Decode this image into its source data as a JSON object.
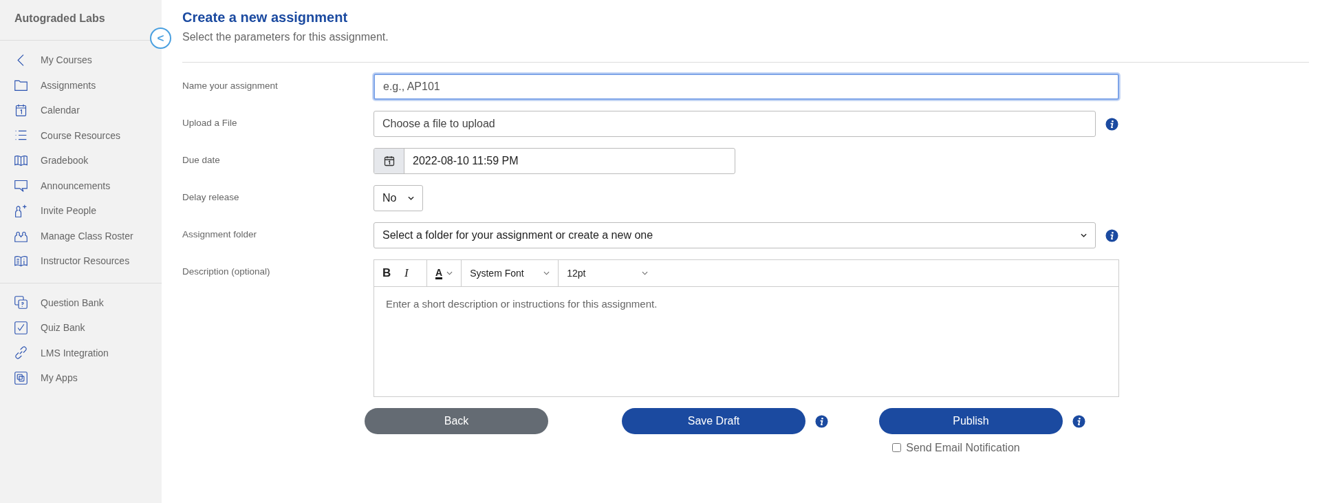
{
  "sidebar": {
    "title": "Autograded Labs",
    "collapse_label": "<",
    "groups": [
      {
        "items": [
          {
            "label": "My Courses",
            "kind": "chevron"
          },
          {
            "label": "Assignments",
            "kind": "folder"
          },
          {
            "label": "Calendar",
            "kind": "calendar"
          },
          {
            "label": "Course Resources",
            "kind": "list"
          },
          {
            "label": "Gradebook",
            "kind": "book"
          },
          {
            "label": "Announcements",
            "kind": "chat"
          },
          {
            "label": "Invite People",
            "kind": "person-plus"
          },
          {
            "label": "Manage Class Roster",
            "kind": "people"
          },
          {
            "label": "Instructor Resources",
            "kind": "book-info"
          }
        ]
      },
      {
        "items": [
          {
            "label": "Question Bank",
            "kind": "question"
          },
          {
            "label": "Quiz Bank",
            "kind": "check"
          },
          {
            "label": "LMS Integration",
            "kind": "link"
          },
          {
            "label": "My Apps",
            "kind": "apps"
          }
        ]
      }
    ]
  },
  "header": {
    "title": "Create a new assignment",
    "subtitle": "Select the parameters for this assignment."
  },
  "form": [
    {
      "kind": "text",
      "label": "Name your assignment",
      "placeholder": "e.g., AP101",
      "focused": true
    },
    {
      "kind": "file",
      "label": "Upload a File",
      "value": "Choose a file to upload",
      "info": true
    },
    {
      "kind": "date",
      "label": "Due date",
      "value": "2022-08-10 11:59 PM"
    },
    {
      "kind": "small-select",
      "label": "Delay release",
      "value": "No"
    },
    {
      "kind": "select",
      "label": "Assignment folder",
      "value": "Select a folder for your assignment or create a new one",
      "info": true
    },
    {
      "kind": "editor",
      "label": "Description (optional)",
      "toolbar": {
        "bold": "B",
        "italic": "I",
        "text_color": "A",
        "font": "System Font",
        "size": "12pt"
      },
      "placeholder": "Enter a short description or instructions for this assignment."
    }
  ],
  "buttons": [
    {
      "label": "Back",
      "kind": "secondary"
    },
    {
      "label": "Save Draft",
      "kind": "primary",
      "info": true
    },
    {
      "label": "Publish",
      "kind": "primary",
      "info": true
    }
  ],
  "notify": {
    "label": "Send Email Notification",
    "checked": false
  }
}
